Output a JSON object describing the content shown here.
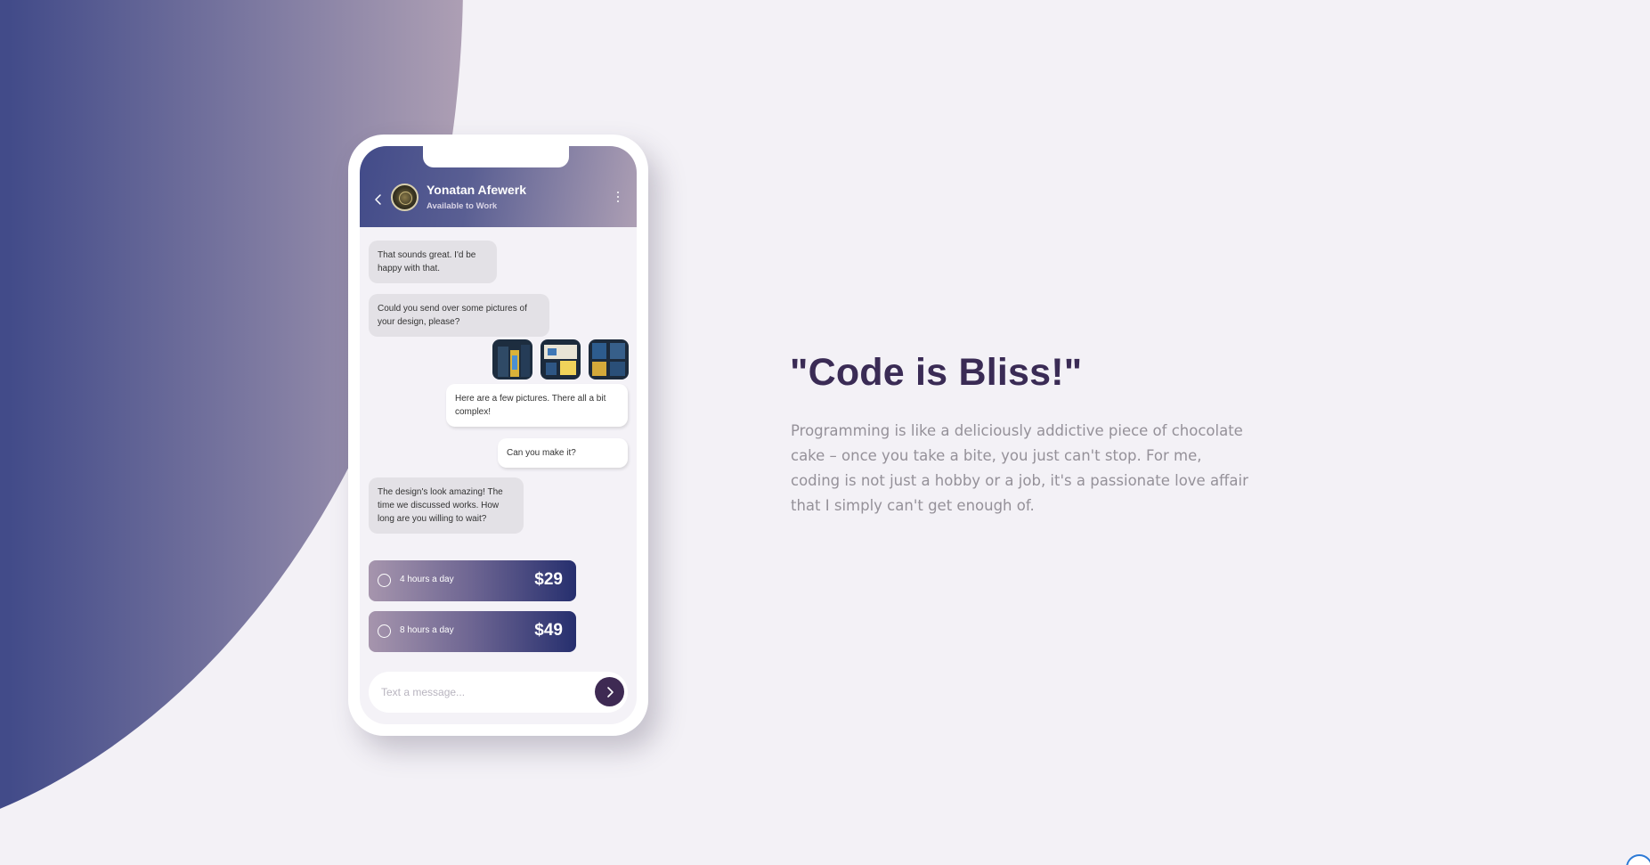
{
  "chat": {
    "contact_name": "Yonatan Afewerk",
    "contact_status": "Available to Work",
    "messages": [
      {
        "from": "contact",
        "text": "That sounds great. I'd be happy with that."
      },
      {
        "from": "contact",
        "text": "Could you send over some pictures of your design, please?"
      },
      {
        "from": "me",
        "text": "Here are a few pictures. There all a bit complex!"
      },
      {
        "from": "me",
        "text": "Can you make it?"
      },
      {
        "from": "contact",
        "text": "The design's look amazing! The time we discussed works. How long are you willing to wait?"
      }
    ],
    "options": [
      {
        "label": "4 hours a day",
        "price": "$29"
      },
      {
        "label": "8 hours a day",
        "price": "$49"
      }
    ],
    "composer_placeholder": "Text a message..."
  },
  "hero": {
    "title": "\"Code is Bliss!\"",
    "text": "Programming is like a deliciously addictive piece of chocolate cake – once you take a bite, you just can't stop. For me, coding is not just a hobby or a job, it's a passionate love affair that I simply can't get enough of."
  },
  "colors": {
    "gradient_start": "#424b89",
    "gradient_end": "#ad9fb4",
    "title_color": "#3a2b55",
    "send_button": "#3e2a53"
  },
  "icons": [
    "back-icon",
    "more-icon",
    "send-icon"
  ]
}
